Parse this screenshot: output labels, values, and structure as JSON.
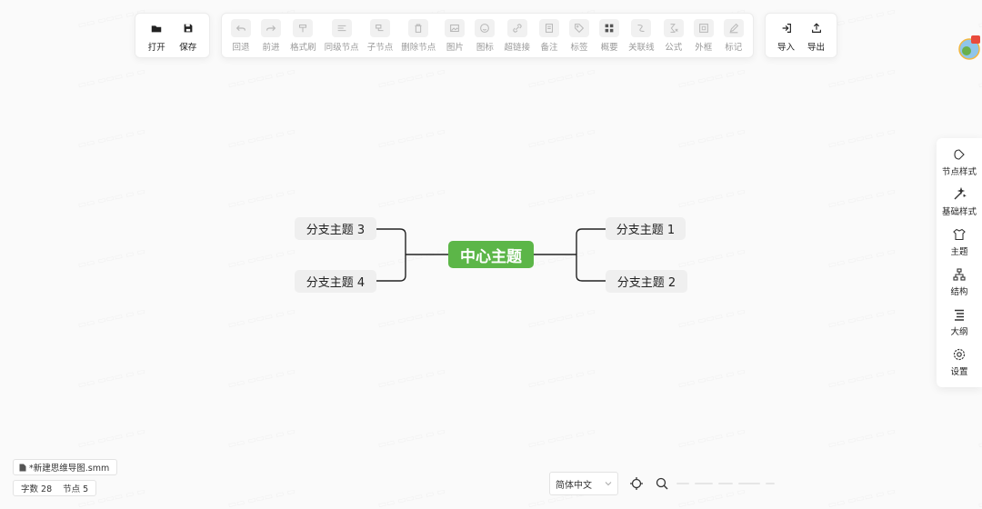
{
  "toolbar": {
    "file_group": [
      {
        "name": "open",
        "label": "打开",
        "icon": "folder-open-icon"
      },
      {
        "name": "save",
        "label": "保存",
        "icon": "floppy-disk-icon"
      }
    ],
    "edit_group": [
      {
        "name": "undo",
        "label": "回退",
        "icon": "undo-icon"
      },
      {
        "name": "redo",
        "label": "前进",
        "icon": "redo-icon"
      },
      {
        "name": "format-painter",
        "label": "格式刷",
        "icon": "format-painter-icon"
      },
      {
        "name": "sibling-node",
        "label": "同级节点",
        "icon": "sibling-node-icon"
      },
      {
        "name": "child-node",
        "label": "子节点",
        "icon": "child-node-icon"
      },
      {
        "name": "delete-node",
        "label": "删除节点",
        "icon": "trash-icon"
      },
      {
        "name": "image",
        "label": "图片",
        "icon": "image-icon"
      },
      {
        "name": "emoji",
        "label": "图标",
        "icon": "smiley-icon"
      },
      {
        "name": "hyperlink",
        "label": "超链接",
        "icon": "link-icon"
      },
      {
        "name": "note",
        "label": "备注",
        "icon": "note-icon"
      },
      {
        "name": "tag",
        "label": "标签",
        "icon": "tag-icon"
      },
      {
        "name": "summary",
        "label": "概要",
        "icon": "grid-icon"
      },
      {
        "name": "association-line",
        "label": "关联线",
        "icon": "association-line-icon"
      },
      {
        "name": "formula",
        "label": "公式",
        "icon": "formula-icon"
      },
      {
        "name": "outer-frame",
        "label": "外框",
        "icon": "frame-icon"
      },
      {
        "name": "mark",
        "label": "标记",
        "icon": "pen-icon"
      }
    ],
    "io_group": [
      {
        "name": "import",
        "label": "导入",
        "icon": "import-icon"
      },
      {
        "name": "export",
        "label": "导出",
        "icon": "export-icon"
      }
    ]
  },
  "side_panel": [
    {
      "name": "node-style",
      "label": "节点样式",
      "icon": "node-style-icon"
    },
    {
      "name": "base-style",
      "label": "基础样式",
      "icon": "magic-wand-icon"
    },
    {
      "name": "theme",
      "label": "主题",
      "icon": "shirt-icon"
    },
    {
      "name": "structure",
      "label": "结构",
      "icon": "structure-icon"
    },
    {
      "name": "outline",
      "label": "大纲",
      "icon": "outline-icon"
    },
    {
      "name": "settings",
      "label": "设置",
      "icon": "settings-icon"
    }
  ],
  "mindmap": {
    "root": "中心主题",
    "branches": [
      "分支主题 1",
      "分支主题 2",
      "分支主题 3",
      "分支主题 4"
    ]
  },
  "status": {
    "file_name": "*新建思维导图.smm",
    "word_count": "字数 28",
    "node_count": "节点 5"
  },
  "bottom": {
    "language": "简体中文"
  },
  "colors": {
    "root_node": "#5cb648",
    "branch_node": "#efefef",
    "accent": "#4a90e2"
  }
}
